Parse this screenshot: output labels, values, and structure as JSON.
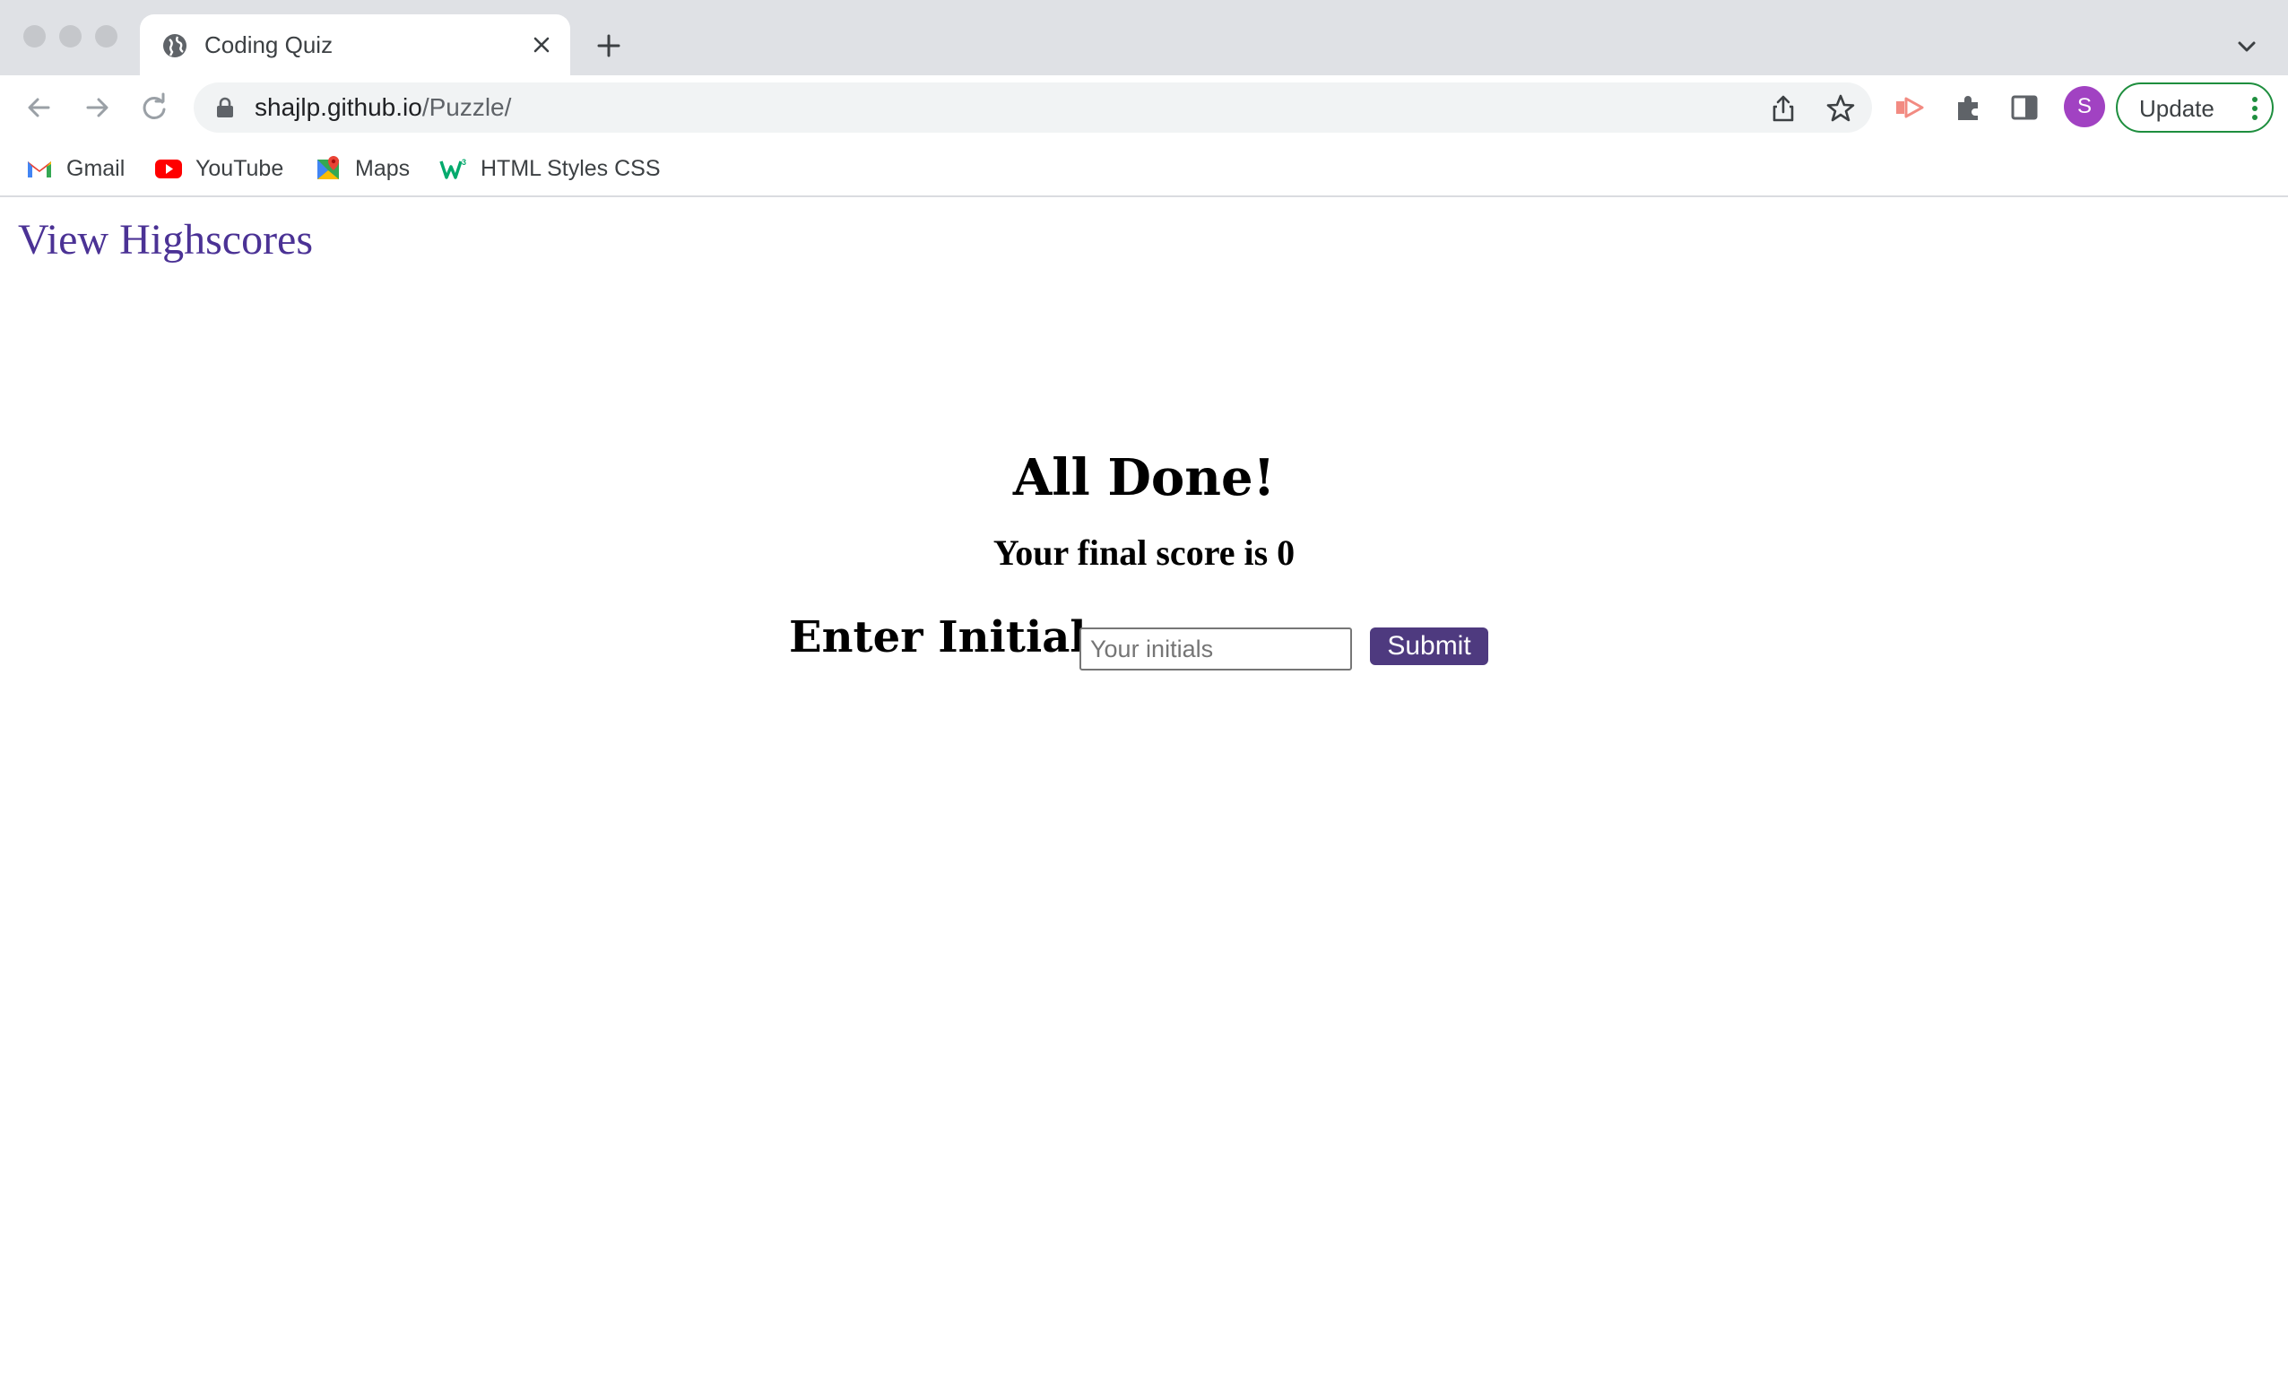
{
  "browser": {
    "tab": {
      "title": "Coding Quiz",
      "favicon": "globe-icon"
    },
    "address": {
      "domain": "shajlp.github.io",
      "path": "/Puzzle/"
    },
    "profile_initial": "S",
    "update_label": "Update",
    "bookmarks": [
      {
        "label": "Gmail",
        "icon": "gmail-icon"
      },
      {
        "label": "YouTube",
        "icon": "youtube-icon"
      },
      {
        "label": "Maps",
        "icon": "maps-icon"
      },
      {
        "label": "HTML Styles CSS",
        "icon": "w3schools-icon"
      }
    ]
  },
  "page": {
    "highscores_link": "View Highscores",
    "title": "All Done!",
    "score_text": "Your final score is",
    "score_value": "0",
    "initials_label": "Enter Initials:",
    "initials_placeholder": "Your initials",
    "initials_value": "",
    "submit_label": "Submit"
  },
  "colors": {
    "link": "#4b3295",
    "submit_bg": "#4e3a7f",
    "avatar": "#a142c2",
    "update_border": "#1e8e3e"
  }
}
